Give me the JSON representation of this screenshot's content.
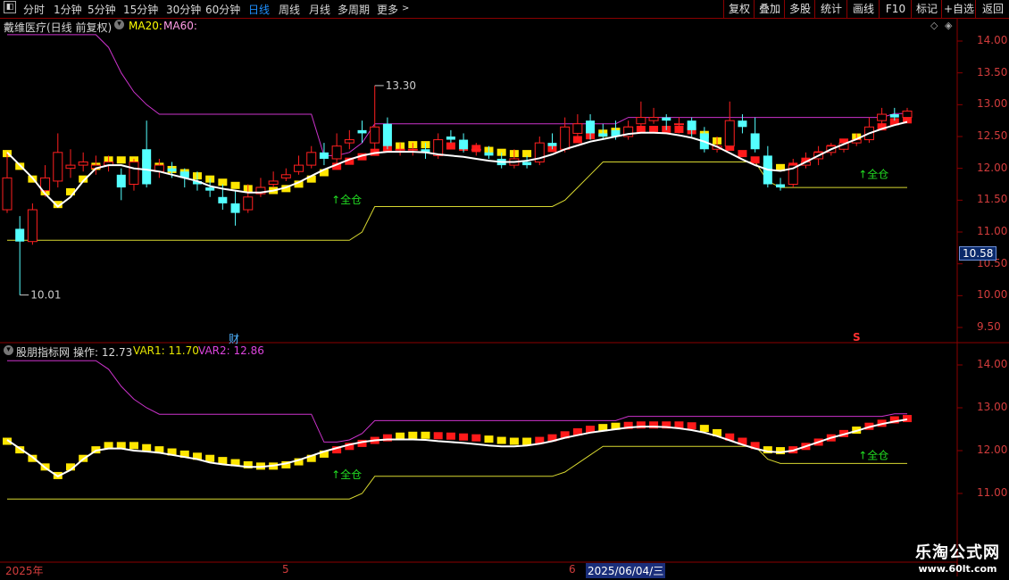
{
  "toolbar": {
    "periods": [
      "分时",
      "1分钟",
      "5分钟",
      "15分钟",
      "30分钟",
      "60分钟",
      "日线",
      "周线",
      "月线",
      "多周期",
      "更多"
    ],
    "active_period": "日线",
    "right_buttons": [
      "复权",
      "叠加",
      "多股",
      "统计",
      "画线",
      "F10",
      "标记",
      "+自选",
      "返回"
    ]
  },
  "main": {
    "stock": "戴维医疗(日线 前复权)",
    "ma20_label": "MA20:",
    "ma60_label": "MA60:",
    "high_marker": "13.30",
    "low_marker": "10.01",
    "buy_signal": "↑全仓",
    "caibao_marker": "财",
    "s_marker": "S",
    "price_tag": "10.58",
    "y_ticks": [
      "14.00",
      "13.50",
      "13.00",
      "12.50",
      "12.00",
      "11.50",
      "11.00",
      "10.50",
      "10.00",
      "9.50"
    ]
  },
  "sub": {
    "title": "股朋指标网",
    "op_label": "操作:",
    "op_value": "12.73",
    "var1_label": "VAR1:",
    "var1_value": "11.70",
    "var2_label": "VAR2:",
    "var2_value": "12.86",
    "buy_signal": "↑全仓",
    "y_ticks": [
      "14.00",
      "13.00",
      "12.00",
      "11.00"
    ]
  },
  "time_axis": {
    "year": "2025年",
    "m5": "5",
    "m6": "6",
    "cursor_date": "2025/06/04/三"
  },
  "logo": {
    "line1": "乐淘公式网",
    "line2": "www.60lt.com"
  },
  "colors": {
    "up": "#ff2020",
    "down": "#54ffff",
    "ma20": "#ffff00",
    "var2": "#cc33cc",
    "var1": "#d8d830",
    "op": "#ffffff"
  },
  "chart_data": {
    "type": "candlestick",
    "candles": [
      [
        11.35,
        11.85,
        12.25,
        11.3
      ],
      [
        11.05,
        10.85,
        11.25,
        10.01
      ],
      [
        10.85,
        11.35,
        11.45,
        10.8
      ],
      [
        11.65,
        11.85,
        12.05,
        11.55
      ],
      [
        11.8,
        12.25,
        12.55,
        11.7
      ],
      [
        12.0,
        12.05,
        12.3,
        11.85
      ],
      [
        12.05,
        12.1,
        12.25,
        11.95
      ],
      [
        12.0,
        12.05,
        12.2,
        11.9
      ],
      [
        12.05,
        12.1,
        12.2,
        11.95
      ],
      [
        11.9,
        11.7,
        12.0,
        11.5
      ],
      [
        11.75,
        12.1,
        12.15,
        11.65
      ],
      [
        12.3,
        11.75,
        12.75,
        11.7
      ],
      [
        11.95,
        12.05,
        12.15,
        11.85
      ],
      [
        12.0,
        11.95,
        12.1,
        11.85
      ],
      [
        11.95,
        11.85,
        12.0,
        11.7
      ],
      [
        11.8,
        11.75,
        11.95,
        11.65
      ],
      [
        11.7,
        11.65,
        11.85,
        11.55
      ],
      [
        11.55,
        11.45,
        11.75,
        11.35
      ],
      [
        11.45,
        11.3,
        11.65,
        11.1
      ],
      [
        11.35,
        11.55,
        11.75,
        11.3
      ],
      [
        11.6,
        11.7,
        11.85,
        11.55
      ],
      [
        11.75,
        11.8,
        11.95,
        11.7
      ],
      [
        11.85,
        11.9,
        12.0,
        11.8
      ],
      [
        11.95,
        12.05,
        12.2,
        11.9
      ],
      [
        12.05,
        12.25,
        12.35,
        12.0
      ],
      [
        12.25,
        12.15,
        12.4,
        12.05
      ],
      [
        12.15,
        12.35,
        12.55,
        12.05
      ],
      [
        12.4,
        12.45,
        12.6,
        12.3
      ],
      [
        12.6,
        12.55,
        12.75,
        12.4
      ],
      [
        12.4,
        12.65,
        13.3,
        12.2
      ],
      [
        12.7,
        12.35,
        12.8,
        12.3
      ],
      [
        12.3,
        12.3,
        12.4,
        12.2
      ],
      [
        12.3,
        12.3,
        12.4,
        12.2
      ],
      [
        12.3,
        12.25,
        12.4,
        12.15
      ],
      [
        12.2,
        12.45,
        12.55,
        12.15
      ],
      [
        12.5,
        12.45,
        12.6,
        12.4
      ],
      [
        12.45,
        12.3,
        12.55,
        12.25
      ],
      [
        12.3,
        12.3,
        12.4,
        12.2
      ],
      [
        12.25,
        12.2,
        12.35,
        12.15
      ],
      [
        12.15,
        12.05,
        12.25,
        12.0
      ],
      [
        12.05,
        12.15,
        12.3,
        12.0
      ],
      [
        12.1,
        12.05,
        12.2,
        12.0
      ],
      [
        12.1,
        12.4,
        12.5,
        12.05
      ],
      [
        12.4,
        12.35,
        12.55,
        12.3
      ],
      [
        12.3,
        12.65,
        12.8,
        12.25
      ],
      [
        12.55,
        12.7,
        12.85,
        12.45
      ],
      [
        12.75,
        12.55,
        12.85,
        12.45
      ],
      [
        12.55,
        12.5,
        12.7,
        12.45
      ],
      [
        12.6,
        12.5,
        12.75,
        12.45
      ],
      [
        12.5,
        12.65,
        12.75,
        12.45
      ],
      [
        12.7,
        12.8,
        13.05,
        12.6
      ],
      [
        12.75,
        12.8,
        12.95,
        12.7
      ],
      [
        12.8,
        12.75,
        12.85,
        12.6
      ],
      [
        12.7,
        12.7,
        12.8,
        12.55
      ],
      [
        12.75,
        12.6,
        12.8,
        12.5
      ],
      [
        12.55,
        12.3,
        12.65,
        12.25
      ],
      [
        12.3,
        12.35,
        12.5,
        12.25
      ],
      [
        12.35,
        12.75,
        13.05,
        12.3
      ],
      [
        12.75,
        12.65,
        12.85,
        12.55
      ],
      [
        12.55,
        12.3,
        12.8,
        12.25
      ],
      [
        12.2,
        11.75,
        12.35,
        11.7
      ],
      [
        11.75,
        11.7,
        11.85,
        11.65
      ],
      [
        11.75,
        12.05,
        12.15,
        11.7
      ],
      [
        12.05,
        12.1,
        12.25,
        12.0
      ],
      [
        12.15,
        12.25,
        12.35,
        12.05
      ],
      [
        12.25,
        12.35,
        12.4,
        12.2
      ],
      [
        12.3,
        12.4,
        12.45,
        12.25
      ],
      [
        12.4,
        12.45,
        12.55,
        12.35
      ],
      [
        12.45,
        12.65,
        12.8,
        12.4
      ],
      [
        12.75,
        12.85,
        12.95,
        12.65
      ],
      [
        12.85,
        12.8,
        12.95,
        12.75
      ],
      [
        12.8,
        12.9,
        12.95,
        12.75
      ]
    ],
    "ma_series": [
      12.2,
      12.0,
      11.8,
      11.6,
      11.4,
      11.6,
      11.8,
      12.0,
      12.1,
      12.1,
      12.1,
      12.05,
      12.0,
      11.95,
      11.9,
      11.85,
      11.8,
      11.75,
      11.7,
      11.65,
      11.62,
      11.62,
      11.65,
      11.72,
      11.8,
      11.9,
      12.0,
      12.08,
      12.15,
      12.22,
      12.28,
      12.32,
      12.34,
      12.34,
      12.33,
      12.32,
      12.3,
      12.28,
      12.25,
      12.22,
      12.2,
      12.2,
      12.22,
      12.28,
      12.35,
      12.42,
      12.48,
      12.52,
      12.55,
      12.57,
      12.58,
      12.58,
      12.58,
      12.58,
      12.56,
      12.5,
      12.4,
      12.3,
      12.2,
      12.1,
      12.0,
      11.98,
      12.0,
      12.08,
      12.18,
      12.28,
      12.38,
      12.46,
      12.55,
      12.62,
      12.7,
      12.73
    ],
    "var2_series": [
      14.1,
      14.1,
      14.1,
      14.1,
      14.1,
      14.1,
      14.1,
      14.1,
      13.9,
      13.5,
      13.2,
      13.0,
      12.85,
      12.85,
      12.85,
      12.85,
      12.85,
      12.85,
      12.85,
      12.85,
      12.85,
      12.85,
      12.85,
      12.85,
      12.85,
      12.2,
      12.2,
      12.25,
      12.4,
      12.7,
      12.7,
      12.7,
      12.7,
      12.7,
      12.7,
      12.7,
      12.7,
      12.7,
      12.7,
      12.7,
      12.7,
      12.7,
      12.7,
      12.7,
      12.7,
      12.7,
      12.7,
      12.7,
      12.7,
      12.8,
      12.8,
      12.8,
      12.8,
      12.8,
      12.8,
      12.8,
      12.8,
      12.8,
      12.8,
      12.8,
      12.8,
      12.8,
      12.8,
      12.8,
      12.8,
      12.8,
      12.8,
      12.8,
      12.8,
      12.8,
      12.86,
      12.86
    ],
    "var1_series": [
      10.87,
      10.87,
      10.87,
      10.87,
      10.87,
      10.87,
      10.87,
      10.87,
      10.87,
      10.87,
      10.87,
      10.87,
      10.87,
      10.87,
      10.87,
      10.87,
      10.87,
      10.87,
      10.87,
      10.87,
      10.87,
      10.87,
      10.87,
      10.87,
      10.87,
      10.87,
      10.87,
      10.87,
      11.0,
      11.4,
      11.4,
      11.4,
      11.4,
      11.4,
      11.4,
      11.4,
      11.4,
      11.4,
      11.4,
      11.4,
      11.4,
      11.4,
      11.4,
      11.4,
      11.5,
      11.7,
      11.9,
      12.1,
      12.1,
      12.1,
      12.1,
      12.1,
      12.1,
      12.1,
      12.1,
      12.1,
      12.1,
      12.1,
      12.1,
      12.1,
      11.8,
      11.7,
      11.7,
      11.7,
      11.7,
      11.7,
      11.7,
      11.7,
      11.7,
      11.7,
      11.7,
      11.7
    ]
  }
}
